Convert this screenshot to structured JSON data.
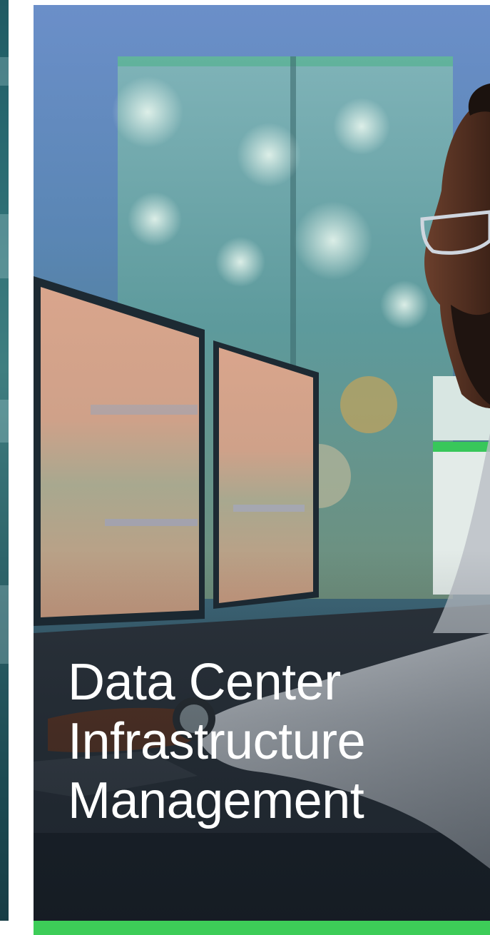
{
  "hero": {
    "title_lines": [
      "Data Center",
      "Infrastructure",
      "Management"
    ],
    "image_subject": "operator-at-monitors-photo"
  },
  "colors": {
    "accent": "#3dcd58",
    "title_text": "#ffffff",
    "background": "#ffffff"
  }
}
